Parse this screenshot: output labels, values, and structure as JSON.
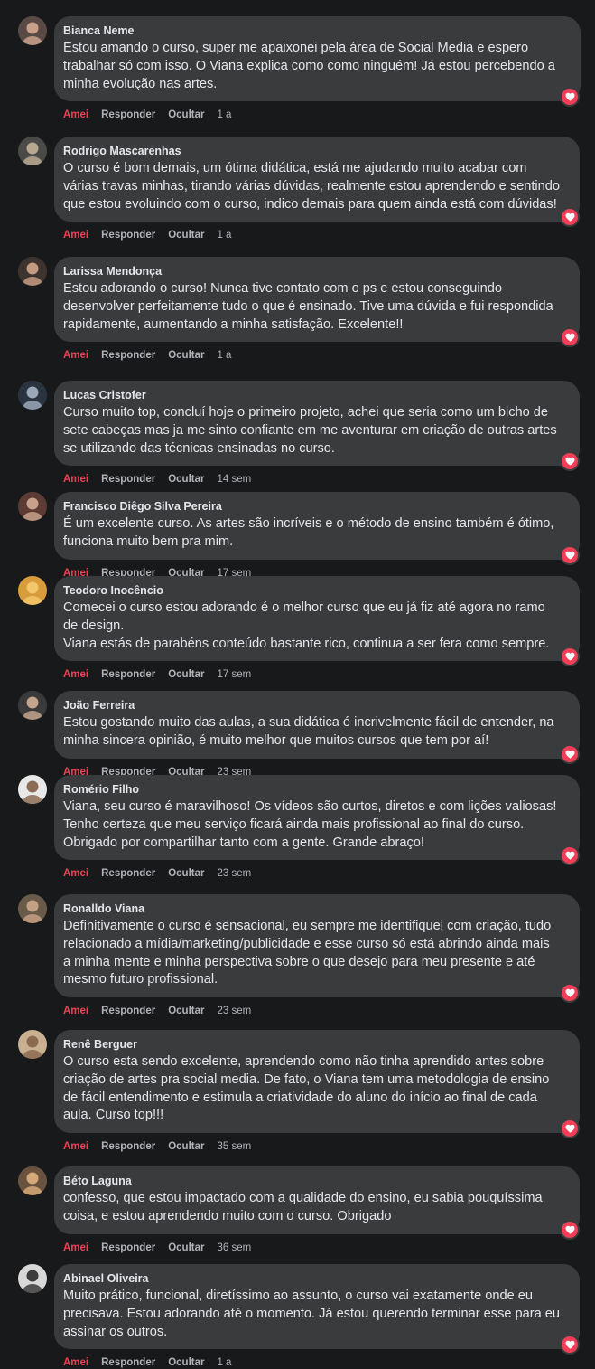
{
  "ui": {
    "like_label": "Amei",
    "reply_label": "Responder",
    "hide_label": "Ocultar"
  },
  "comments": [
    {
      "author": "Bianca Neme",
      "lines": [
        "Estou amando o curso, super me apaixonei pela área de Social Media e espero",
        "trabalhar só com isso. O Viana explica como como ninguém! Já estou percebendo a",
        "minha evolução nas artes."
      ],
      "time": "1 a"
    },
    {
      "author": "Rodrigo Mascarenhas",
      "lines": [
        "O curso é bom demais, um ótima didática, está me ajudando muito acabar com",
        "várias travas minhas, tirando várias dúvidas, realmente estou aprendendo e sentindo",
        "que estou evoluindo com o curso, indico demais para quem ainda está com dúvidas!"
      ],
      "time": "1 a"
    },
    {
      "author": "Larissa Mendonça",
      "lines": [
        "Estou adorando o curso! Nunca tive contato com o ps e estou conseguindo",
        "desenvolver perfeitamente tudo o que é ensinado. Tive uma dúvida e fui respondida",
        "rapidamente, aumentando a minha satisfação. Excelente!!"
      ],
      "time": "1 a"
    },
    {
      "author": "Lucas Cristofer",
      "lines": [
        "Curso muito top, concluí hoje o primeiro projeto, achei que seria como um bicho de",
        "sete cabeças mas ja me sinto confiante em me aventurar em criação de outras artes",
        "se utilizando das técnicas ensinadas no curso."
      ],
      "time": "14 sem"
    },
    {
      "author": "Francisco Diêgo Silva Pereira",
      "lines": [
        "É um excelente curso. As artes são incríveis e o método de ensino também é ótimo,",
        "funciona muito bem pra mim."
      ],
      "time": "17 sem"
    },
    {
      "author": "Teodoro Inocêncio",
      "lines": [
        "Comecei o curso estou adorando é o melhor curso que eu já fiz até agora no ramo",
        "de design.",
        "Viana estás de parabéns conteúdo bastante rico, continua a ser fera como sempre."
      ],
      "time": "17 sem"
    },
    {
      "author": "João Ferreira",
      "lines": [
        "Estou gostando muito das aulas, a sua didática é incrivelmente fácil de entender, na",
        "minha sincera opinião, é muito melhor que muitos cursos que tem por aí!"
      ],
      "time": "23 sem"
    },
    {
      "author": "Romério Filho",
      "lines": [
        "Viana, seu curso é maravilhoso! Os vídeos são curtos, diretos e com lições valiosas!",
        "Tenho certeza que meu serviço ficará ainda mais profissional ao final do curso.",
        "Obrigado por compartilhar tanto com a gente. Grande abraço!"
      ],
      "time": "23 sem"
    },
    {
      "author": "Ronalldo Viana",
      "lines": [
        "Definitivamente o curso é sensacional, eu sempre me identifiquei com criação, tudo",
        "relacionado a mídia/marketing/publicidade e esse curso só está abrindo ainda mais",
        "a minha mente e minha perspectiva sobre o que desejo para meu presente e até",
        "mesmo futuro profissional."
      ],
      "time": "23 sem"
    },
    {
      "author": "Renê Berguer",
      "lines": [
        "O curso esta sendo excelente, aprendendo como não tinha aprendido antes sobre",
        "criação de artes pra social media. De fato, o Viana tem uma metodologia de ensino",
        "de fácil entendimento e estimula a criatividade do aluno do início ao final de cada",
        "aula. Curso top!!!"
      ],
      "time": "35 sem"
    },
    {
      "author": "Béto Laguna",
      "lines": [
        "confesso, que estou impactado com a qualidade do ensino, eu sabia pouquíssima",
        "coisa, e estou aprendendo muito com o curso. Obrigado"
      ],
      "time": "36 sem"
    },
    {
      "author": "Abinael Oliveira",
      "lines": [
        "Muito prático, funcional, diretíssimo ao assunto, o curso vai exatamente onde eu",
        "precisava. Estou adorando até o momento. Já estou querendo terminar esse para eu",
        "assinar os outros."
      ],
      "time": "1 a"
    }
  ]
}
